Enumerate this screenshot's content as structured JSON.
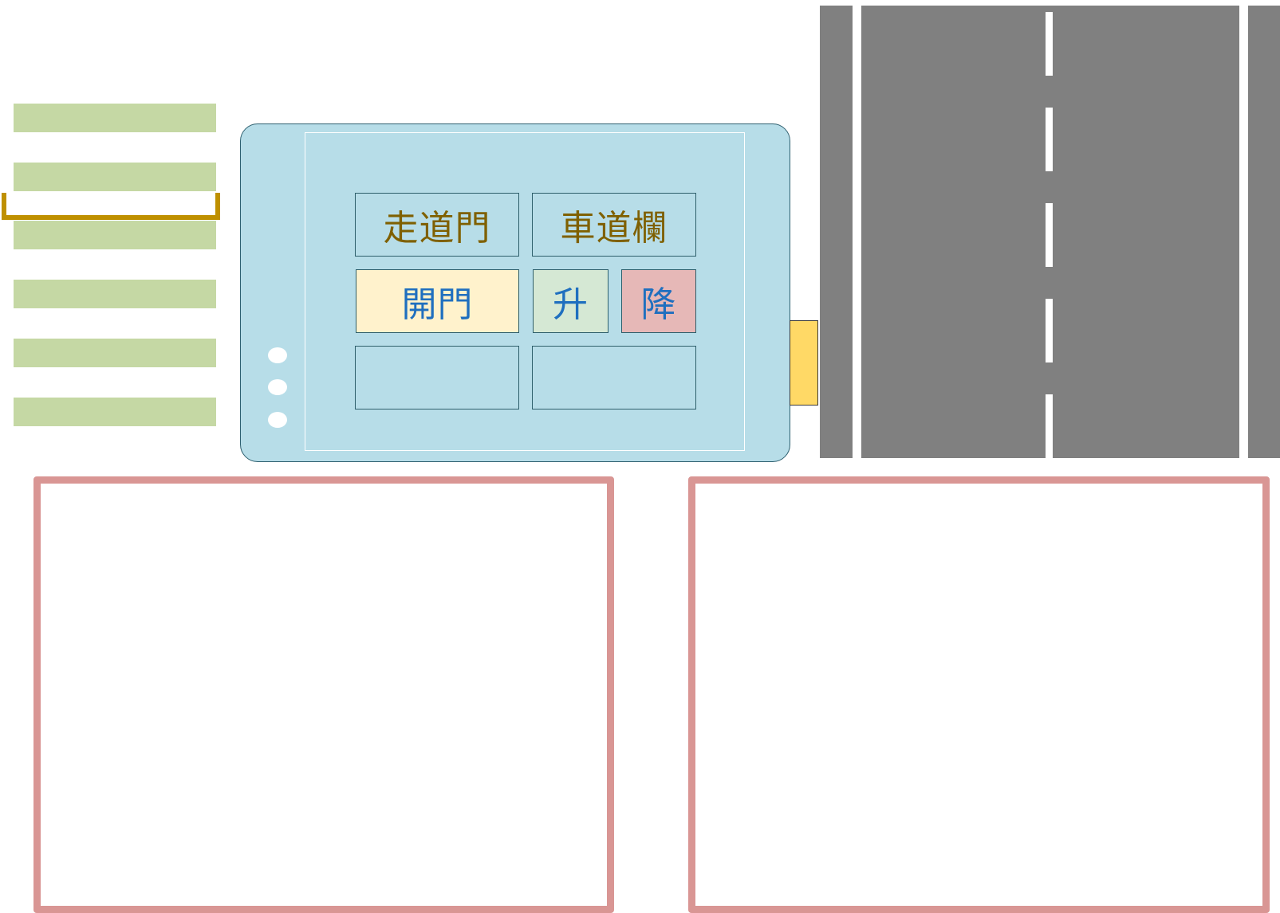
{
  "panel": {
    "walkway_gate_label": "走道門",
    "vehicle_barrier_label": "車道欄",
    "open_button_label": "開門",
    "raise_button_label": "升",
    "lower_button_label": "降"
  },
  "colors": {
    "crosswalk": "#c5d8a4",
    "gate_bar": "#bf9000",
    "tablet": "#b7dde8",
    "open_button": "#fff2cc",
    "raise_button": "#d5e8d4",
    "lower_button": "#e6b8b7",
    "header_text": "#7f6000",
    "button_text": "#1f6fbf",
    "road": "#808080",
    "frame_border": "#d99694",
    "sensor": "#ffd966"
  }
}
